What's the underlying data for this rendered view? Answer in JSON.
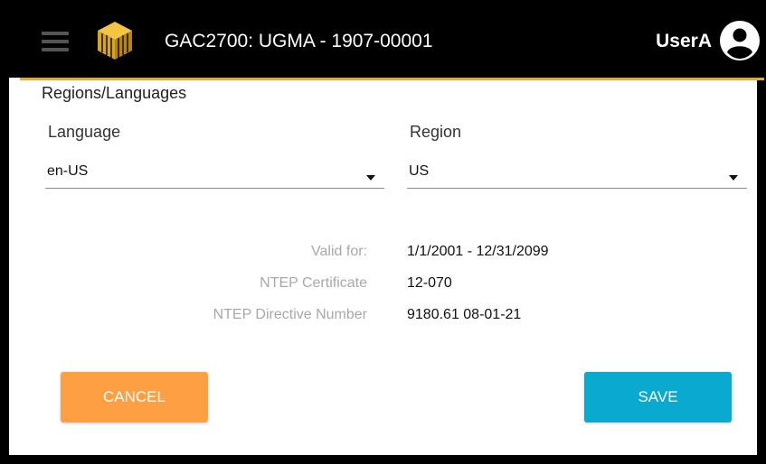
{
  "header": {
    "title": "GAC2700: UGMA - 1907-00001",
    "username": "UserA",
    "menu_icon": "hamburger-menu-icon",
    "logo_icon": "gold-cube-logo",
    "user_icon": "account-circle-icon"
  },
  "page": {
    "section_title": "Regions/Languages"
  },
  "language": {
    "label": "Language",
    "value": "en-US"
  },
  "region": {
    "label": "Region",
    "value": "US"
  },
  "info": {
    "valid_for_label": "Valid for:",
    "valid_for_value": "1/1/2001 - 12/31/2099",
    "ntep_certificate_label": "NTEP Certificate",
    "ntep_certificate_value": "12-070",
    "ntep_directive_label": "NTEP Directive Number",
    "ntep_directive_value": "9180.61 08-01-21"
  },
  "actions": {
    "cancel_label": "CANCEL",
    "save_label": "SAVE"
  },
  "colors": {
    "header_bg": "#000000",
    "accent": "#e8a834",
    "cancel_button": "#ff9f43",
    "save_button": "#0aa9cf",
    "info_label": "#a8a8a8"
  }
}
